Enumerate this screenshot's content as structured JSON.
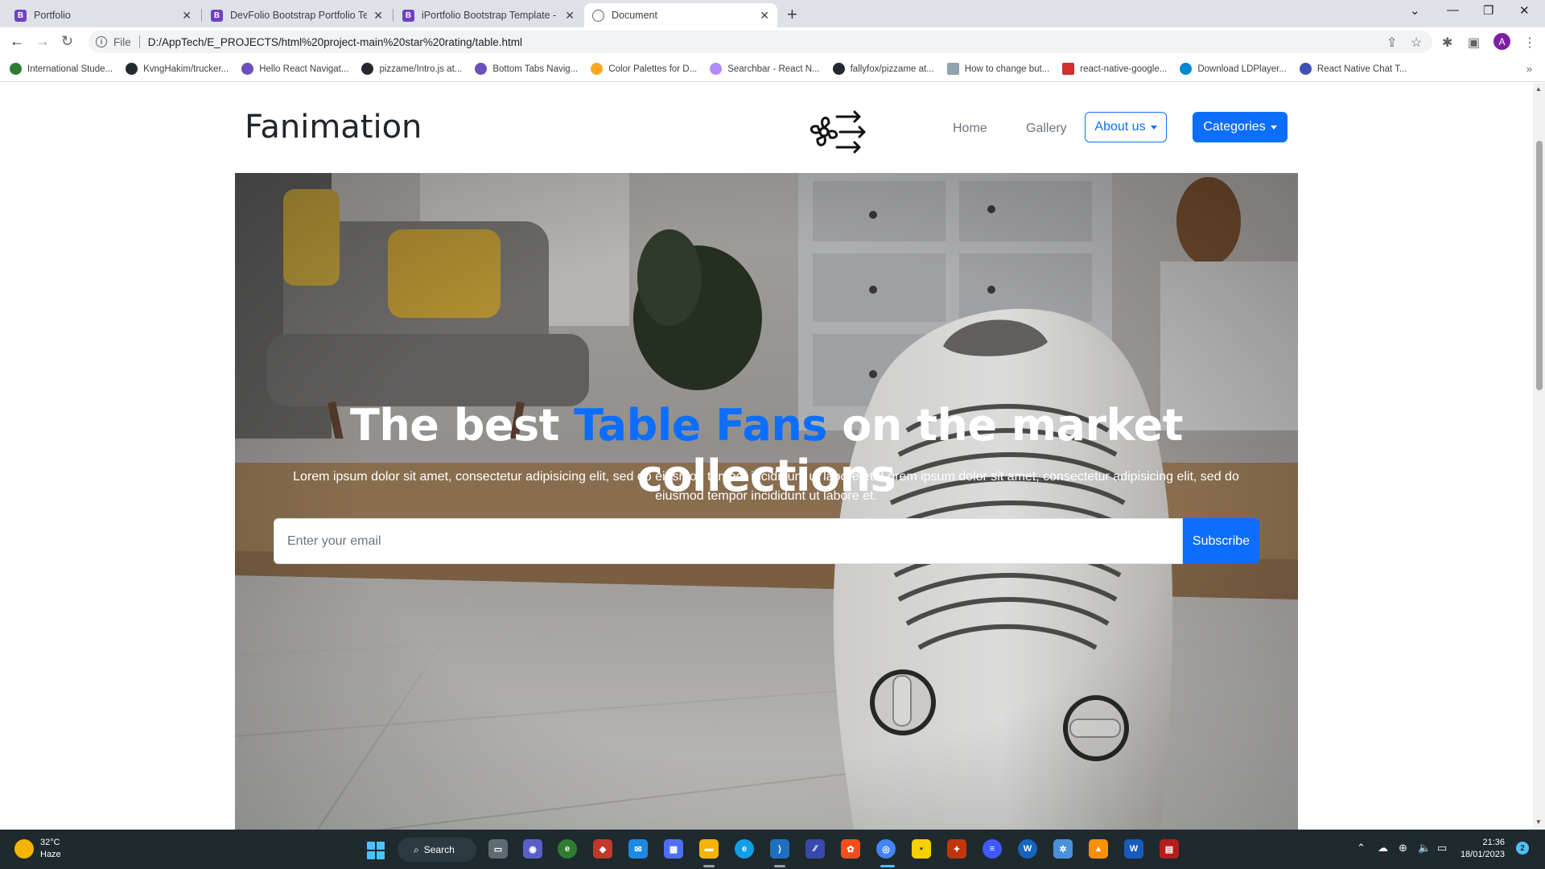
{
  "browser": {
    "tabs": [
      {
        "title": "Portfolio",
        "icon": "bootstrap-icon"
      },
      {
        "title": "DevFolio Bootstrap Portfolio Tem",
        "icon": "bootstrap-icon"
      },
      {
        "title": "iPortfolio Bootstrap Template - Ir",
        "icon": "bootstrap-icon"
      },
      {
        "title": "Document",
        "icon": "globe-icon"
      }
    ],
    "active_tab": "Document",
    "scheme_label": "File",
    "url": "D:/AppTech/E_PROJECTS/html%20project-main%20star%20rating/table.html",
    "profile_initial": "A",
    "bookmarks": [
      {
        "label": "International Stude...",
        "color": "#2e7d32"
      },
      {
        "label": "KvngHakim/trucker...",
        "color": "#24292f"
      },
      {
        "label": "Hello React Navigat...",
        "color": "#6b4fbb"
      },
      {
        "label": "pizzame/Intro.js at...",
        "color": "#24292f"
      },
      {
        "label": "Bottom Tabs Navig...",
        "color": "#6b4fbb"
      },
      {
        "label": "Color Palettes for D...",
        "color": "#f9a825"
      },
      {
        "label": "Searchbar - React N...",
        "color": "#b388ff"
      },
      {
        "label": "fallyfox/pizzame at...",
        "color": "#24292f"
      },
      {
        "label": "How to change but...",
        "color": "#90a4ae"
      },
      {
        "label": "react-native-google...",
        "color": "#d32f2f"
      },
      {
        "label": "Download LDPlayer...",
        "color": "#0288d1"
      },
      {
        "label": "React Native Chat T...",
        "color": "#3f51b5"
      }
    ]
  },
  "site": {
    "brand": "Fanimation",
    "logo_icon": "fan-logo-icon",
    "nav": {
      "home": "Home",
      "gallery": "Gallery",
      "about": "About us",
      "categories": "Categories"
    },
    "hero": {
      "title_before": "The best ",
      "title_highlight": "Table Fans",
      "title_after": " on the market collections",
      "description": "Lorem ipsum dolor sit amet, consectetur adipisicing elit, sed do eiusmod tempor incididunt ut labore et. Lorem ipsum dolor sit amet, consectetur adipisicing elit, sed do eiusmod tempor incididunt ut labore et.",
      "email_placeholder": "Enter your email",
      "subscribe_label": "Subscribe"
    },
    "colors": {
      "primary": "#0d6efd",
      "text_dark": "#212529",
      "text_muted": "#6c757d"
    }
  },
  "taskbar": {
    "weather_temp": "32°C",
    "weather_desc": "Haze",
    "search_label": "Search",
    "time": "21:36",
    "date": "18/01/2023",
    "notification_count": "2"
  }
}
